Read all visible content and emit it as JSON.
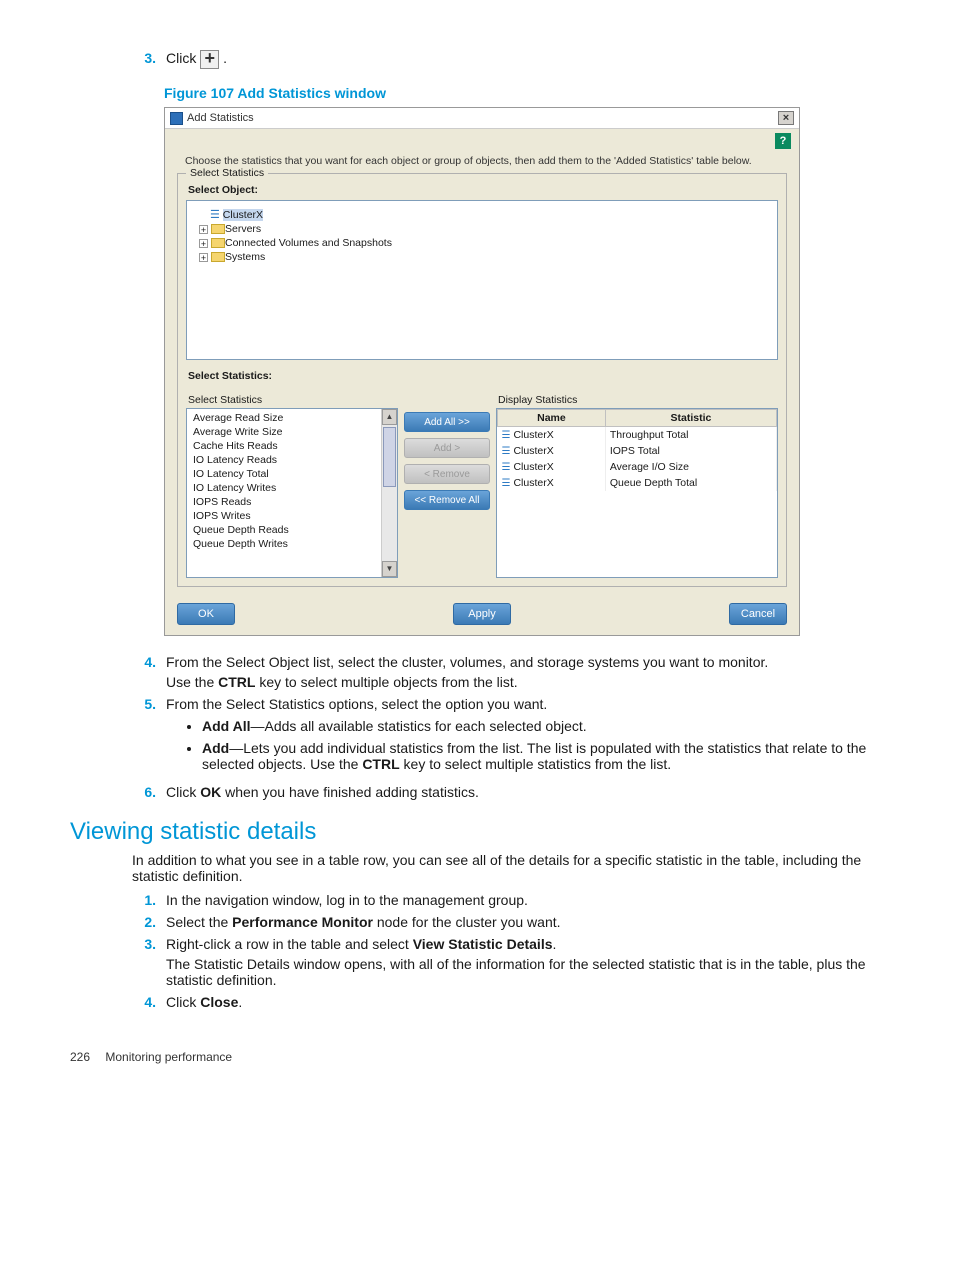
{
  "step3": {
    "num": "3.",
    "pre": "Click ",
    "plus": "+",
    "post": " ."
  },
  "figure_caption": "Figure 107 Add Statistics window",
  "window": {
    "title": "Add Statistics",
    "help": "?",
    "close": "×",
    "instruction": "Choose the statistics that you want for each object or group of objects, then add them to the 'Added Statistics' table below.",
    "fieldset_legend": "Select Statistics",
    "select_object_label": "Select Object:",
    "tree": {
      "root": "ClusterX",
      "children": [
        "Servers",
        "Connected Volumes and Snapshots",
        "Systems"
      ]
    },
    "select_statistics_label": "Select Statistics:",
    "select_statistics_sub": "Select Statistics",
    "stats_list": [
      "Average Read Size",
      "Average Write Size",
      "Cache Hits Reads",
      "IO Latency Reads",
      "IO Latency Total",
      "IO Latency Writes",
      "IOPS Reads",
      "IOPS Writes",
      "Queue Depth Reads",
      "Queue Depth Writes"
    ],
    "buttons": {
      "add_all": "Add All >>",
      "add": "Add >",
      "remove": "< Remove",
      "remove_all": "<< Remove All"
    },
    "display_label": "Display Statistics",
    "table_headers": {
      "name": "Name",
      "statistic": "Statistic"
    },
    "display_rows": [
      {
        "name": "ClusterX",
        "stat": "Throughput Total"
      },
      {
        "name": "ClusterX",
        "stat": "IOPS Total"
      },
      {
        "name": "ClusterX",
        "stat": "Average I/O Size"
      },
      {
        "name": "ClusterX",
        "stat": "Queue Depth Total"
      }
    ],
    "ok": "OK",
    "apply": "Apply",
    "cancel": "Cancel"
  },
  "step4": {
    "num": "4.",
    "line1": "From the Select Object list, select the cluster, volumes, and storage systems you want to monitor.",
    "line2_pre": "Use the ",
    "line2_b": "CTRL",
    "line2_post": " key to select multiple objects from the list."
  },
  "step5": {
    "num": "5.",
    "line1": "From the Select Statistics options, select the option you want.",
    "bullets": [
      {
        "b": "Add All",
        "rest": "—Adds all available statistics for each selected object."
      },
      {
        "b": "Add",
        "rest": "—Lets you add individual statistics from the list. The list is populated with the statistics that relate to the selected objects. Use the ",
        "b2": "CTRL",
        "rest2": " key to select multiple statistics from the list."
      }
    ]
  },
  "step6": {
    "num": "6.",
    "pre": "Click ",
    "b": "OK",
    "post": " when you have finished adding statistics."
  },
  "section_heading": "Viewing statistic details",
  "section_intro": "In addition to what you see in a table row, you can see all of the details for a specific statistic in the table, including the statistic definition.",
  "v_steps": {
    "s1": {
      "num": "1.",
      "text": "In the navigation window, log in to the management group."
    },
    "s2": {
      "num": "2.",
      "pre": "Select the ",
      "b": "Performance Monitor",
      "post": " node for the cluster you want."
    },
    "s3": {
      "num": "3.",
      "pre": "Right-click a row in the table and select ",
      "b": "View Statistic Details",
      "post": ".",
      "after": "The Statistic Details window opens, with all of the information for the selected statistic that is in the table, plus the statistic definition."
    },
    "s4": {
      "num": "4.",
      "pre": "Click ",
      "b": "Close",
      "post": "."
    }
  },
  "footer": {
    "page": "226",
    "title": "Monitoring performance"
  }
}
